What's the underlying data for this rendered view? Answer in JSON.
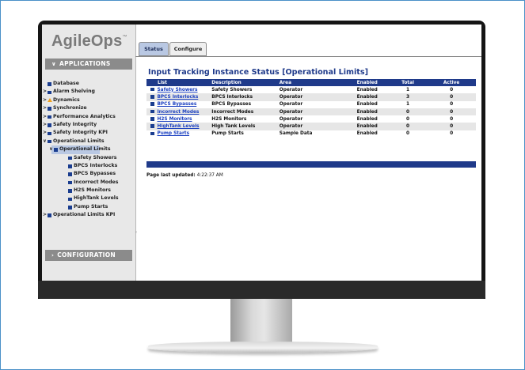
{
  "app": {
    "logo_text": "AgileOps",
    "logo_mark": "™"
  },
  "sidebar": {
    "applications_label": "APPLICATIONS",
    "configuration_label": "CONFIGURATION",
    "items": [
      {
        "label": "Database",
        "icon": "square-icon",
        "expandable": false,
        "level": 0
      },
      {
        "label": "Alarm Shelving",
        "icon": "square-icon",
        "expandable": true,
        "level": 0
      },
      {
        "label": "Dynamics",
        "icon": "warning-triangle-icon",
        "expandable": true,
        "level": 0
      },
      {
        "label": "Synchronize",
        "icon": "square-icon",
        "expandable": true,
        "level": 0
      },
      {
        "label": "Performance Analytics",
        "icon": "square-icon",
        "expandable": true,
        "level": 0
      },
      {
        "label": "Safety Integrity",
        "icon": "square-icon",
        "expandable": true,
        "level": 0
      },
      {
        "label": "Safety Integrity KPI",
        "icon": "square-icon",
        "expandable": true,
        "level": 0
      },
      {
        "label": "Operational Limits",
        "icon": "square-icon",
        "expandable": true,
        "expanded": true,
        "level": 0
      },
      {
        "label": "Operational Limits",
        "icon": "square-icon",
        "expandable": true,
        "expanded": true,
        "selected": true,
        "level": 1
      },
      {
        "label": "Safety Showers",
        "icon": "square-icon",
        "level": 2
      },
      {
        "label": "BPCS Interlocks",
        "icon": "square-icon",
        "level": 2
      },
      {
        "label": "BPCS Bypasses",
        "icon": "square-icon",
        "level": 2
      },
      {
        "label": "Incorrect Modes",
        "icon": "square-icon",
        "level": 2
      },
      {
        "label": "H2S Monitors",
        "icon": "square-icon",
        "level": 2
      },
      {
        "label": "HighTank Levels",
        "icon": "square-icon",
        "level": 2
      },
      {
        "label": "Pump Starts",
        "icon": "square-icon",
        "level": 2
      },
      {
        "label": "Operational Limits KPI",
        "icon": "square-icon",
        "expandable": true,
        "level": 0
      }
    ]
  },
  "tabs": [
    {
      "label": "Status",
      "active": true
    },
    {
      "label": "Configure",
      "active": false
    }
  ],
  "main": {
    "title": "Input Tracking Instance Status [Operational Limits]",
    "columns": [
      "List",
      "Description",
      "Area",
      "Enabled",
      "Total",
      "Active"
    ],
    "rows": [
      {
        "list": "Safety Showers",
        "description": "Safety Showers",
        "area": "Operator",
        "enabled": "Enabled",
        "total": "1",
        "active": "0"
      },
      {
        "list": "BPCS Interlocks",
        "description": "BPCS Interlocks",
        "area": "Operator",
        "enabled": "Enabled",
        "total": "3",
        "active": "0"
      },
      {
        "list": "BPCS Bypasses",
        "description": "BPCS Bypasses",
        "area": "Operator",
        "enabled": "Enabled",
        "total": "1",
        "active": "0"
      },
      {
        "list": "Incorrect Modes",
        "description": "Incorrect Modes",
        "area": "Operator",
        "enabled": "Enabled",
        "total": "0",
        "active": "0"
      },
      {
        "list": "H2S Monitors",
        "description": "H2S Monitors",
        "area": "Operator",
        "enabled": "Enabled",
        "total": "0",
        "active": "0"
      },
      {
        "list": "HighTank Levels",
        "description": "High Tank Levels",
        "area": "Operator",
        "enabled": "Enabled",
        "total": "0",
        "active": "0"
      },
      {
        "list": "Pump Starts",
        "description": "Pump Starts",
        "area": "Sample Data",
        "enabled": "Enabled",
        "total": "0",
        "active": "0"
      }
    ],
    "updated_label": "Page last updated:",
    "updated_time": "4:22:37 AM"
  },
  "colors": {
    "header_blue": "#1f3a8a",
    "link_blue": "#1a3fc0",
    "selected_bg": "#b9c8e3",
    "warning": "#f0a020"
  }
}
